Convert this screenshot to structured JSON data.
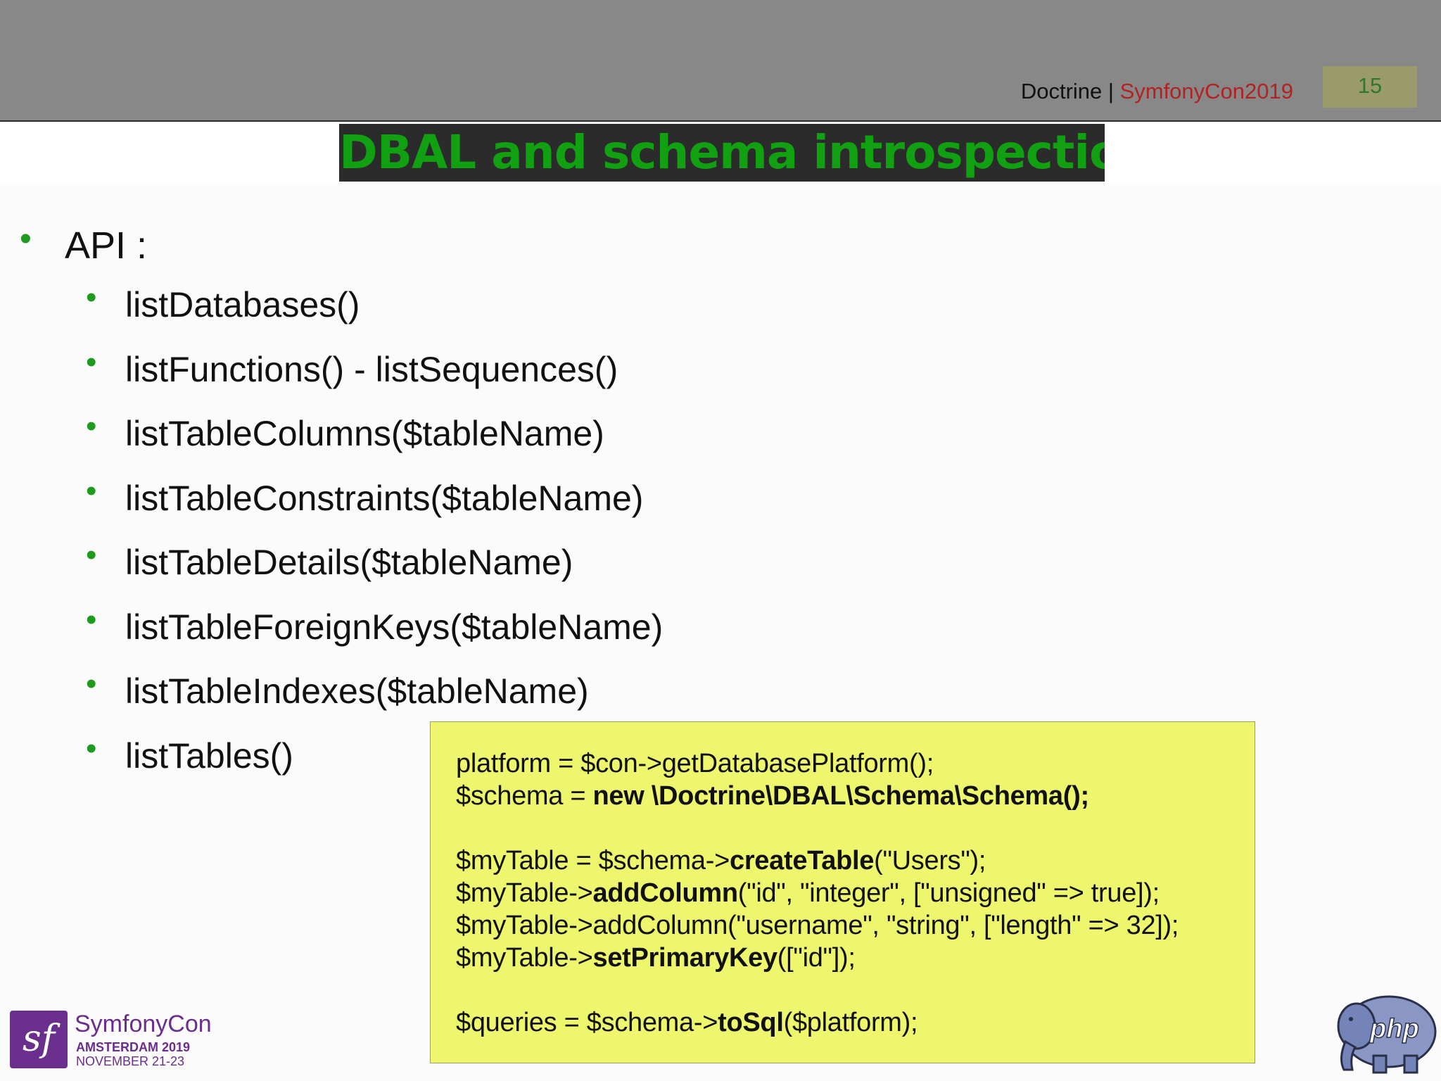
{
  "header": {
    "source_name": "Doctrine",
    "separator": " | ",
    "event_name": "SymfonyCon2019",
    "slide_number": "15"
  },
  "slide": {
    "title": "DBAL and schema introspection",
    "bullet_main": "API :",
    "sub_bullets": [
      "listDatabases()",
      "listFunctions() - listSequences()",
      "listTableColumns($tableName)",
      "listTableConstraints($tableName)",
      "listTableDetails($tableName)",
      "listTableForeignKeys($tableName)",
      "listTableIndexes($tableName)",
      "listTables()"
    ]
  },
  "code": {
    "line1": "platform = $con->getDatabasePlatform();",
    "line2_a": "$schema = ",
    "line2_b": "new \\Doctrine\\DBAL\\Schema\\Schema();",
    "line3_a": "$myTable = $schema->",
    "line3_b": "createTable",
    "line3_c": "(\"Users\");",
    "line4_a": "$myTable->",
    "line4_b": "addColumn",
    "line4_c": "(\"id\", \"integer\", [\"unsigned\" => true]);",
    "line5": "$myTable->addColumn(\"username\", \"string\", [\"length\" => 32]);",
    "line6_a": "$myTable->",
    "line6_b": "setPrimaryKey",
    "line6_c": "([\"id\"]);",
    "line7_a": "$queries = $schema->",
    "line7_b": "toSql",
    "line7_c": "($platform);"
  },
  "footer": {
    "logo_glyph": "sf",
    "conference_name": "SymfonyCon",
    "conference_city": "AMSTERDAM 2019",
    "conference_dates": "NOVEMBER 21-23",
    "php_logo_text": "php"
  },
  "colors": {
    "header_bg": "#888888",
    "title_bg": "#2b2b2b",
    "title_text": "#11a011",
    "bullet_dot": "#1e9a1e",
    "code_bg": "#eef66e",
    "event_text": "#b22222",
    "symfony_purple": "#6a2e8c",
    "php_blue": "#6b7bb3"
  }
}
